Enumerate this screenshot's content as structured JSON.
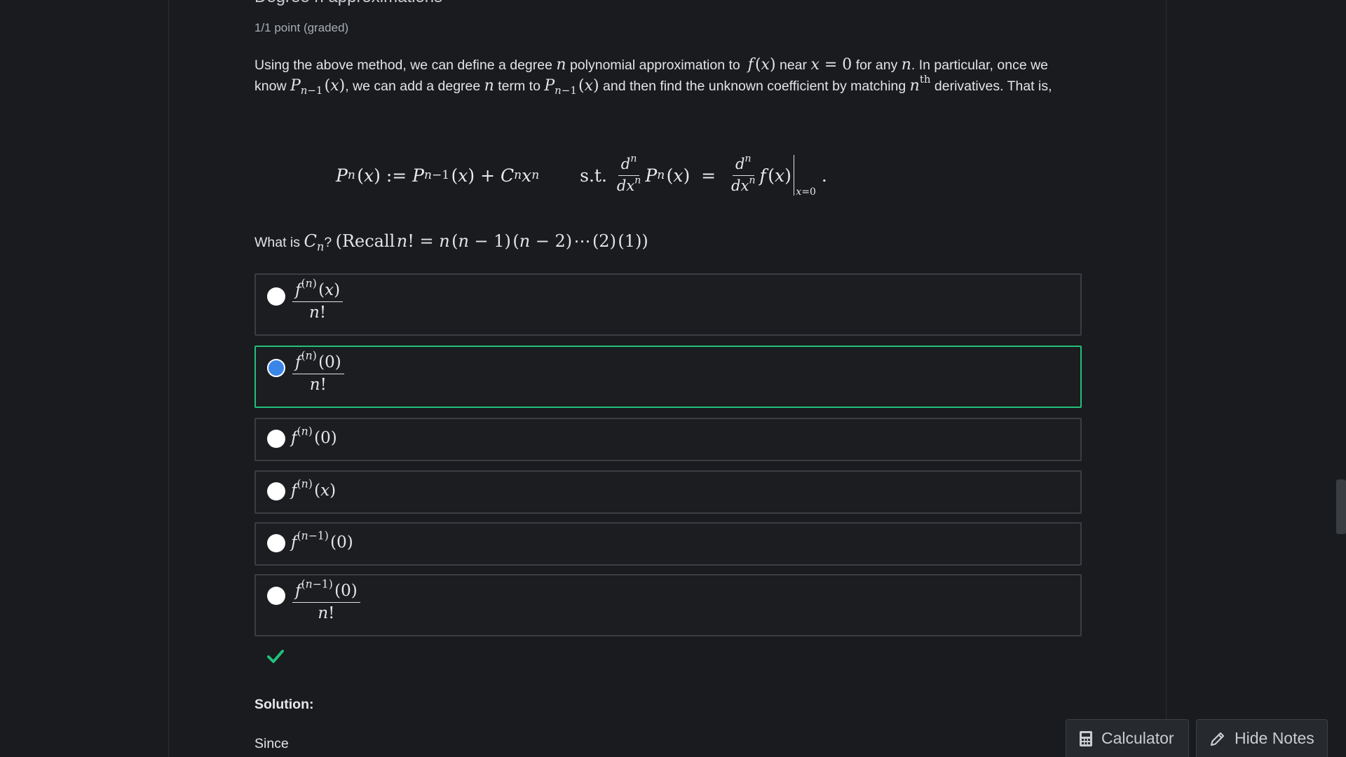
{
  "problem": {
    "title": "Degree n approximations",
    "points": "1/1 point (graded)"
  },
  "intro": {
    "t1": "Using the above method, we can define a degree ",
    "t2": " polynomial approximation to ",
    "t3": " near ",
    "t4": " for any ",
    "t5": ". In particular, once we know ",
    "t6": ", we can add a degree ",
    "t7": " term to ",
    "t8": " and then find the unknown coefficient by matching ",
    "t9": " derivatives. That is,"
  },
  "display_text": {
    "st": "s.t."
  },
  "question": {
    "prefix": "What is ",
    "suffix": "? ",
    "recall": "Recall"
  },
  "options": [
    {
      "id": "opt1",
      "selected": false
    },
    {
      "id": "opt2",
      "selected": true
    },
    {
      "id": "opt3",
      "selected": false
    },
    {
      "id": "opt4",
      "selected": false
    },
    {
      "id": "opt5",
      "selected": false
    },
    {
      "id": "opt6",
      "selected": false
    }
  ],
  "status": {
    "correct": true,
    "icon": "checkmark-icon",
    "color": "#21c07a"
  },
  "solution": {
    "label": "Solution:",
    "first_word": "Since"
  },
  "footer": {
    "calculator_label": "Calculator",
    "calculator_icon": "calculator-icon",
    "notes_label": "Hide Notes",
    "notes_icon": "pencil-icon"
  },
  "colors": {
    "background": "#191b1e",
    "selected_border": "#21c07a",
    "radio_checked": "#3a86e8"
  }
}
